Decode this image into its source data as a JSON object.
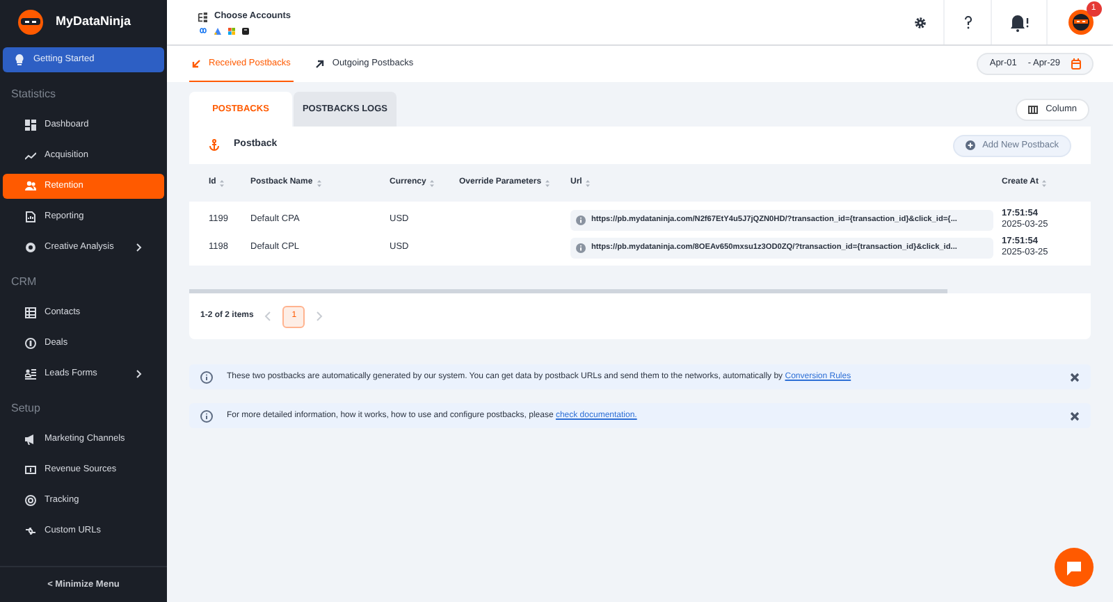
{
  "sidebar": {
    "logo": "MyDataNinja",
    "items": [
      {
        "kind": "featured",
        "label": "Getting Started",
        "selected": false
      },
      {
        "kind": "section",
        "label": "Statistics"
      },
      {
        "kind": "item",
        "label": "Dashboard",
        "selected": false
      },
      {
        "kind": "item",
        "label": "Acquisition",
        "selected": false
      },
      {
        "kind": "item",
        "label": "Retention",
        "selected": true
      },
      {
        "kind": "item",
        "label": "Reporting",
        "selected": false
      },
      {
        "kind": "item",
        "label": "Creative Analysis",
        "selected": false,
        "submenu": true
      },
      {
        "kind": "section",
        "label": "CRM"
      },
      {
        "kind": "item",
        "label": "Contacts",
        "selected": false
      },
      {
        "kind": "item",
        "label": "Deals",
        "selected": false
      },
      {
        "kind": "item",
        "label": "Leads Forms",
        "selected": false,
        "submenu": true
      },
      {
        "kind": "section",
        "label": "Setup"
      },
      {
        "kind": "item",
        "label": "Marketing Channels",
        "selected": false
      },
      {
        "kind": "item",
        "label": "Revenue Sources",
        "selected": false
      },
      {
        "kind": "item",
        "label": "Tracking",
        "selected": false
      },
      {
        "kind": "item",
        "label": "Custom URLs",
        "selected": false
      }
    ],
    "minimize": "< Minimize Menu"
  },
  "header": {
    "accounts_label": "Choose Accounts",
    "notification_count": "1"
  },
  "subtabs": [
    {
      "label": "Received Postbacks",
      "selected": true
    },
    {
      "label": "Outgoing Postbacks",
      "selected": false
    }
  ],
  "date_range": {
    "from": "Apr-01",
    "to": "- Apr-29"
  },
  "tabs": [
    {
      "label": "POSTBACKS",
      "selected": true
    },
    {
      "label": "POSTBACKS LOGS",
      "selected": false
    }
  ],
  "column_button": "Column",
  "panel": {
    "title": "Postback",
    "add_button": "Add New Postback"
  },
  "table": {
    "columns": [
      "Id",
      "Postback Name",
      "Currency",
      "Override Parameters",
      "Url",
      "Create At"
    ],
    "rows": [
      {
        "id": "1199",
        "name": "Default CPA",
        "currency": "USD",
        "url": "https://pb.mydataninja.com/N2f67EtY4u5J7jQZN0HD/?transaction_id={transaction_id}&click_id={...",
        "time": "17:51:54",
        "date": "2025-03-25"
      },
      {
        "id": "1198",
        "name": "Default CPL",
        "currency": "USD",
        "url": "https://pb.mydataninja.com/8OEAv650mxsu1z3OD0ZQ/?transaction_id={transaction_id}&click_id...",
        "time": "17:51:54",
        "date": "2025-03-25"
      }
    ]
  },
  "pagination": {
    "summary": "1-2 of 2 items",
    "pages": [
      {
        "label": "1",
        "selected": true
      }
    ]
  },
  "notices": [
    {
      "text": "These two postbacks are automatically generated by our system. You can get data by postback URLs and send them to the networks, automatically by ",
      "link": "Conversion Rules"
    },
    {
      "text": "For more detailed information, how it works, how to use and configure postbacks, please ",
      "link": "check documentation."
    }
  ]
}
